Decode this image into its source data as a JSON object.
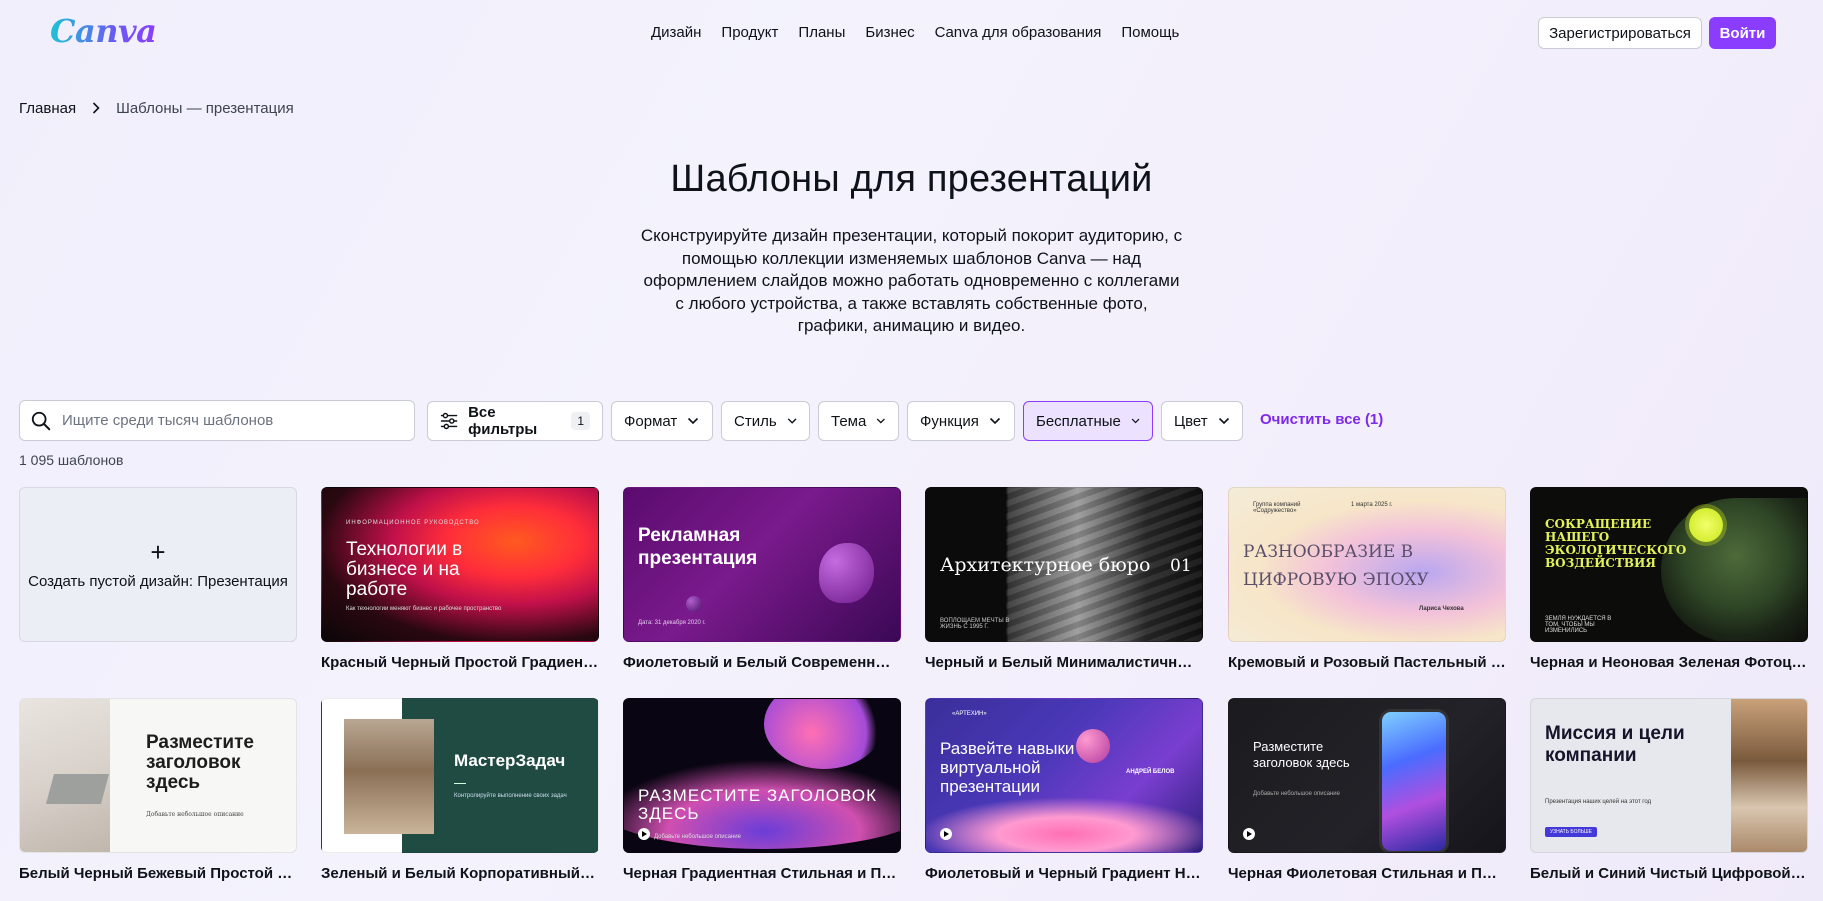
{
  "header": {
    "logo": "Canva",
    "nav": [
      "Дизайн",
      "Продукт",
      "Планы",
      "Бизнес",
      "Canva для образования",
      "Помощь"
    ],
    "register": "Зарегистрироваться",
    "login": "Войти"
  },
  "breadcrumb": {
    "home": "Главная",
    "current": "Шаблоны — презентация"
  },
  "hero": {
    "title": "Шаблоны для презентаций",
    "description": "Сконструируйте дизайн презентации, который покорит аудиторию, с помощью коллекции изменяемых шаблонов Canva — над оформлением слайдов можно работать одновременно с коллегами с любого устройства, а также вставлять собственные фото, графики, анимацию и видео."
  },
  "filters": {
    "search_placeholder": "Ищите среди тысяч шаблонов",
    "all_filters": "Все фильтры",
    "all_filters_count": "1",
    "format": "Формат",
    "style": "Стиль",
    "theme": "Тема",
    "function": "Функция",
    "free": "Бесплатные",
    "color": "Цвет",
    "clear_all": "Очистить все (1)"
  },
  "results_count": "1 095 шаблонов",
  "blank_card": {
    "plus": "+",
    "label": "Создать пустой дизайн: Презентация"
  },
  "templates": [
    {
      "caption": "Красный Черный Простой Градиент…",
      "t1": "ИНФОРМАЦИОННОЕ РУКОВОДСТВО",
      "t2": "Технологии в бизнесе и на работе",
      "t3": "Как технологии меняют бизнес и рабочее пространство"
    },
    {
      "caption": "Фиолетовый и Белый Современный …",
      "t1": "Рекламная презентация",
      "t2": "Дата: 31 декабря 2020 г."
    },
    {
      "caption": "Черный и Белый Минималистичный…",
      "t1": "Архитектурное бюро",
      "t2": "01",
      "t3": "ВОПЛОЩАЕМ МЕЧТЫ В ЖИЗНЬ С 1995 Г."
    },
    {
      "caption": "Кремовый и Розовый Пастельный Гр…",
      "t1": "РАЗНООБРАЗИЕ В ЦИФРОВУЮ ЭПОХУ",
      "t2": "Группа компаний «Содружество»",
      "t3": "1 марта 2025 г.",
      "t4": "Лариса Чехова"
    },
    {
      "caption": "Черная и Неоновая Зеленая Фотоцен…",
      "t1": "СОКРАЩЕНИЕ НАШЕГО ЭКОЛОГИЧЕСКОГО ВОЗДЕЙСТВИЯ",
      "t2": "ЗЕМЛЯ НУЖДАЕТСЯ В ТОМ, ЧТОБЫ МЫ ИЗМЕНИЛИСЬ"
    },
    {
      "caption": "Белый Черный Бежевый Простой Ко…",
      "t1": "Разместите заголовок здесь",
      "t2": "Добавьте небольшое описание"
    },
    {
      "caption": "Зеленый и Белый Корпоративный П…",
      "t1": "МастерЗадач",
      "t2": "Контролируйте выполнение своих задач"
    },
    {
      "caption": "Черная Градиентная Стильная и Про…",
      "t1": "РАЗМЕСТИТЕ ЗАГОЛОВОК ЗДЕСЬ",
      "t2": "Добавьте небольшое описание"
    },
    {
      "caption": "Фиолетовый и Черный Градиент Нав…",
      "t1": "Развейте навыки виртуальной презентации",
      "t2": "«АРТЕХИН»",
      "t3": "АНДРЕЙ БЕЛОВ"
    },
    {
      "caption": "Черная Фиолетовая Стильная и Про…",
      "t1": "Разместите заголовок здесь",
      "t2": "Добавьте небольшое описание"
    },
    {
      "caption": "Белый и Синий Чистый Цифровой П…",
      "t1": "Миссия и цели компании",
      "t2": "Презентация наших целей на этот год",
      "t3": "УЗНАТЬ БОЛЬШЕ"
    }
  ]
}
